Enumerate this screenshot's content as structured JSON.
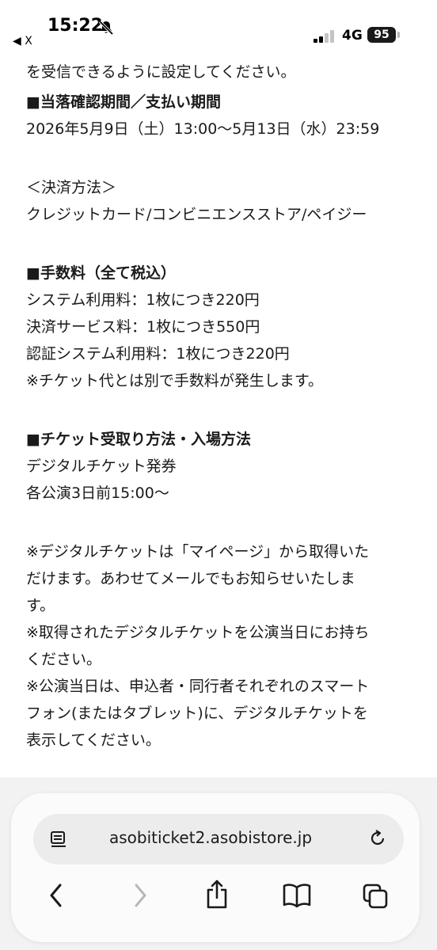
{
  "status": {
    "time": "15:22",
    "back_label": "◀ X",
    "network": "4G",
    "battery": "95"
  },
  "content": {
    "cut_line": "を受信できるように設定してください。",
    "heading_period": "■当落確認期間／支払い期間",
    "period_text": "2026年5月9日（土）13:00〜5月13日（水）23:59",
    "payment_label": "＜決済方法＞",
    "payment_methods": "クレジットカード/コンビニエンスストア/ペイジー",
    "heading_fees": "■手数料（全て税込）",
    "fee_system": "システム利用料：1枚につき220円",
    "fee_payment": "決済サービス料：1枚につき550円",
    "fee_auth": "認証システム利用料：1枚につき220円",
    "fee_note": "※チケット代とは別で手数料が発生します。",
    "heading_ticket": "■チケット受取り方法・入場方法",
    "ticket_type": "デジタルチケット発券",
    "ticket_time": "各公演3日前15:00〜",
    "note1_l1": "※デジタルチケットは「マイページ」から取得いた",
    "note1_l2": "だけます。あわせてメールでもお知らせいたしま",
    "note1_l3": "す。",
    "note2_l1": "※取得されたデジタルチケットを公演当日にお持ち",
    "note2_l2": "ください。",
    "note3_l1": "※公演当日は、申込者・同行者それぞれのスマート",
    "note3_l2": "フォン(またはタブレット)に、デジタルチケットを",
    "note3_l3": "表示してください。"
  },
  "browser": {
    "url": "asobiticket2.asobistore.jp"
  }
}
